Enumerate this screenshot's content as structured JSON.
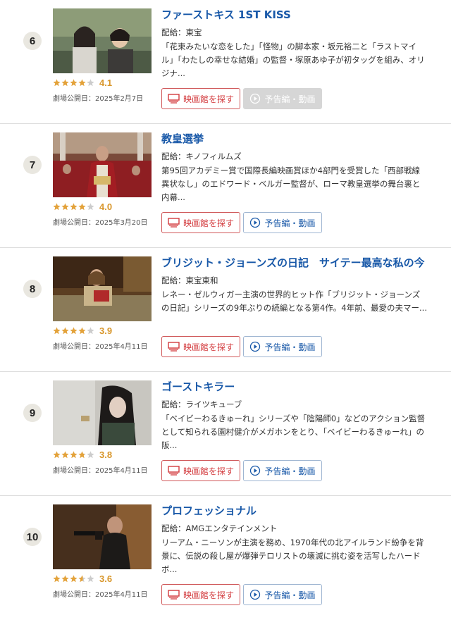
{
  "labels": {
    "distributor_prefix": "配給：",
    "release_prefix": "劇場公開日：",
    "theater_button": "映画館を探す",
    "trailer_button": "予告編・動画"
  },
  "colors": {
    "title": "#1858a8",
    "score": "#d8962a",
    "star_filled": "#e3a23a",
    "star_empty": "#cccccc",
    "theater_button": "#d33b3e",
    "rank_badge": "#e9e7e0"
  },
  "icons": {
    "theater": "film-screen-icon",
    "trailer": "play-circle-icon",
    "rating": "star-icon"
  },
  "movies": [
    {
      "rank": "6",
      "title": "ファーストキス 1ST KISS",
      "distributor": "東宝",
      "description": "「花束みたいな恋をした」「怪物」の脚本家・坂元裕二と「ラストマイル」「わたしの幸せな結婚」の監督・塚原あゆ子が初タッグを組み、オリジナ...",
      "rating": 4.1,
      "score": "4.1",
      "release_date": "2025年2月7日",
      "trailer_available": false
    },
    {
      "rank": "7",
      "title": "教皇選挙",
      "distributor": "キノフィルムズ",
      "description": "第95回アカデミー賞で国際長編映画賞ほか4部門を受賞した「西部戦線異状なし」のエドワード・ベルガー監督が、ローマ教皇選挙の舞台裏と内幕...",
      "rating": 4.0,
      "score": "4.0",
      "release_date": "2025年3月20日",
      "trailer_available": true
    },
    {
      "rank": "8",
      "title": "ブリジット・ジョーンズの日記　サイテー最高な私の今",
      "distributor": "東宝東和",
      "description": "レネー・ゼルウィガー主演の世界的ヒット作「ブリジット・ジョーンズの日記」シリーズの9年ぶりの続編となる第4作。4年前、最愛の夫マー...",
      "rating": 3.9,
      "score": "3.9",
      "release_date": "2025年4月11日",
      "trailer_available": true
    },
    {
      "rank": "9",
      "title": "ゴーストキラー",
      "distributor": "ライツキューブ",
      "description": "「ベイビーわるきゅーれ」シリーズや「陰陽師0」などのアクション監督として知られる園村健介がメガホンをとり、「ベイビーわるきゅーれ」の阪...",
      "rating": 3.8,
      "score": "3.8",
      "release_date": "2025年4月11日",
      "trailer_available": true
    },
    {
      "rank": "10",
      "title": "プロフェッショナル",
      "distributor": "AMGエンタテインメント",
      "description": "リーアム・ニーソンが主演を務め、1970年代の北アイルランド紛争を背景に、伝説の殺し屋が爆弾テロリストの壊滅に挑む姿を活写したハードボ...",
      "rating": 3.6,
      "score": "3.6",
      "release_date": "2025年4月11日",
      "trailer_available": true
    }
  ]
}
